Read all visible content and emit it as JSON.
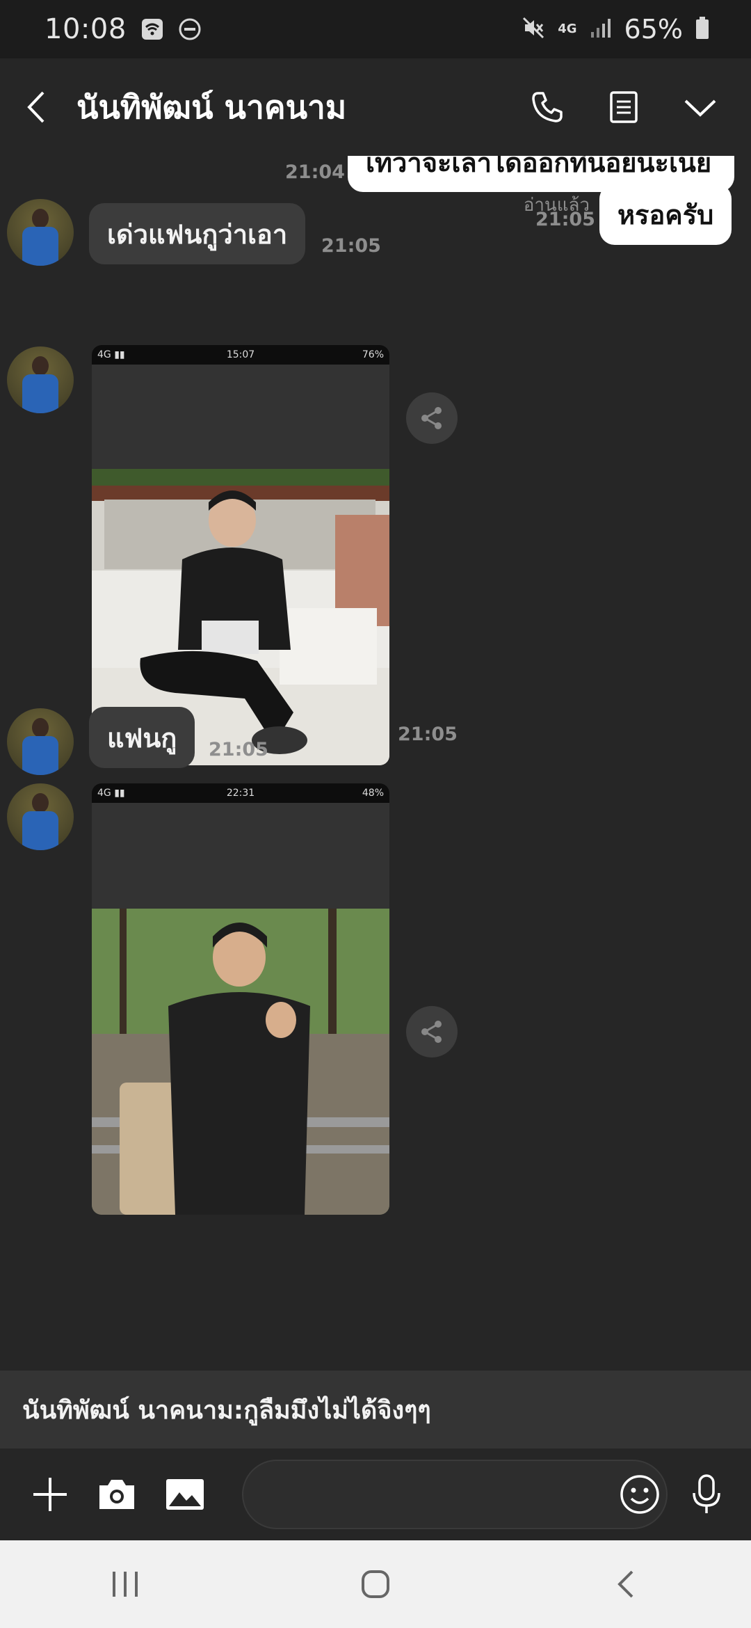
{
  "status_bar": {
    "time": "10:08",
    "network": "4G",
    "battery": "65%"
  },
  "header": {
    "title": "นันทิพัฒน์ นาคนาม"
  },
  "messages": {
    "m1": {
      "text": "เทวาจะเล่าไดออกทีนอยนะเนย",
      "time": "21:04"
    },
    "m2": {
      "text": "เด่วแฟนกูว่าเอา",
      "time": "21:05"
    },
    "m3": {
      "text": "หรอครับ",
      "read": "อ่านแล้ว",
      "time": "21:05"
    },
    "m4": {
      "screenshot_time": "15:07",
      "screenshot_battery": "76%",
      "time": "21:05"
    },
    "m5": {
      "text": "แฟนกู",
      "time": "21:05"
    },
    "m6": {
      "screenshot_time": "22:31",
      "screenshot_battery": "48%"
    }
  },
  "notice": {
    "text": "นันทิพัฒน์ นาคนาม:กูลืมมึงไม่ได้จิงๆๆ"
  },
  "composer": {
    "input_value": "",
    "placeholder": ""
  },
  "colors": {
    "background": "#262626",
    "outgoing_bubble": "#ffffff",
    "incoming_bubble": "#3c3c3c",
    "timestamp": "#8e8e8e",
    "navbar": "#f1f1f1"
  }
}
